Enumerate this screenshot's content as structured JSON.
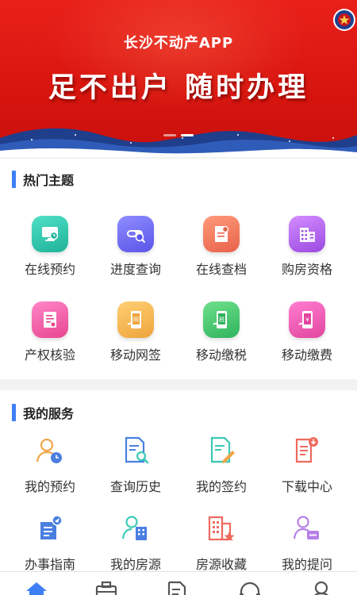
{
  "banner": {
    "subtitle": "长沙不动产APP",
    "headline": "足不出户 随时办理",
    "slides": 2,
    "active_slide": 2
  },
  "hot_topics": {
    "title": "热门主题",
    "items": [
      {
        "label": "在线预约",
        "icon": "monitor-clock-icon"
      },
      {
        "label": "进度查询",
        "icon": "progress-search-icon"
      },
      {
        "label": "在线查档",
        "icon": "document-seal-icon"
      },
      {
        "label": "购房资格",
        "icon": "building-qualification-icon"
      },
      {
        "label": "产权核验",
        "icon": "certificate-verify-icon"
      },
      {
        "label": "移动网签",
        "icon": "phone-sign-icon"
      },
      {
        "label": "移动缴税",
        "icon": "phone-tax-icon"
      },
      {
        "label": "移动缴费",
        "icon": "phone-payment-icon"
      }
    ]
  },
  "my_services": {
    "title": "我的服务",
    "items": [
      {
        "label": "我的预约",
        "icon": "user-clock-icon"
      },
      {
        "label": "查询历史",
        "icon": "doc-search-icon"
      },
      {
        "label": "我的签约",
        "icon": "doc-pen-icon"
      },
      {
        "label": "下载中心",
        "icon": "doc-download-icon"
      },
      {
        "label": "办事指南",
        "icon": "guide-send-icon"
      },
      {
        "label": "我的房源",
        "icon": "user-building-icon"
      },
      {
        "label": "房源收藏",
        "icon": "building-star-icon"
      },
      {
        "label": "我的提问",
        "icon": "user-chat-icon"
      }
    ]
  },
  "tabbar": {
    "tabs": [
      {
        "icon": "home-icon",
        "active": true
      },
      {
        "icon": "briefcase-icon",
        "active": false
      },
      {
        "icon": "document-icon",
        "active": false
      },
      {
        "icon": "headset-icon",
        "active": false
      },
      {
        "icon": "user-icon",
        "active": false
      }
    ]
  },
  "colors": {
    "banner_red": "#e8201a",
    "accent_blue": "#3d7ff5",
    "icon_orange": "#f0a64a",
    "icon_blue": "#4a7fe0",
    "icon_teal": "#3cc9b4",
    "icon_pink": "#ef6a5e",
    "icon_purple": "#b77fe8"
  }
}
